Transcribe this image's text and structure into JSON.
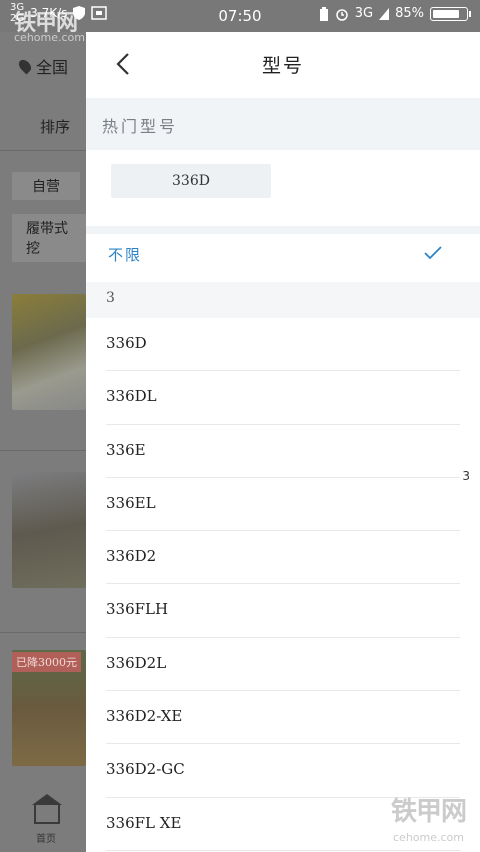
{
  "status_bar": {
    "network_top": "3G",
    "network_bottom": "2G",
    "speed": "3.7K/s",
    "time": "07:50",
    "network_right": "3G",
    "battery": "85%",
    "battery_level": 0.85
  },
  "watermark": {
    "text": "铁甲网",
    "sub": "cehome.com"
  },
  "background_page": {
    "location": "全国",
    "sort": "排序",
    "chip_self": "自营",
    "chip_type": "履带式挖",
    "badge": "已降3000元",
    "home_label": "首页"
  },
  "drawer": {
    "title": "型号",
    "hot_section_title": "热门型号",
    "hot_models": [
      "336D"
    ],
    "unlimited_label": "不限",
    "group_letter": "3",
    "models": [
      "336D",
      "336DL",
      "336E",
      "336EL",
      "336D2",
      "336FLH",
      "336D2L",
      "336D2-XE",
      "336D2-GC",
      "336FL XE"
    ],
    "index_letter": "3"
  },
  "colors": {
    "accent": "#2d84c7",
    "section_bg": "#f1f4f7",
    "overlay": "#7f7f7f"
  }
}
